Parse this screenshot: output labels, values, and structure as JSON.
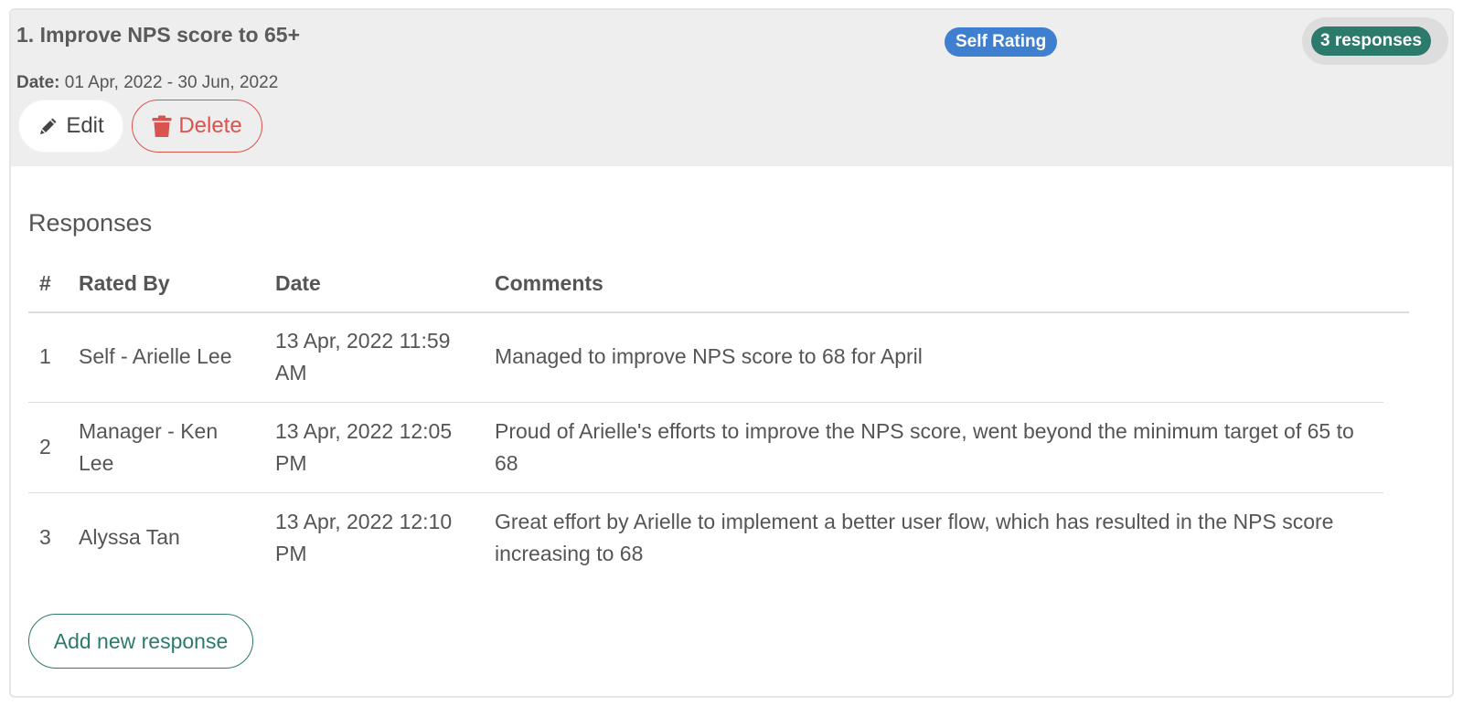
{
  "goal": {
    "title": "1. Improve NPS score to 65+",
    "rating_badge": "Self Rating",
    "responses_badge": "3 responses",
    "date_label": "Date:",
    "date_value": "01 Apr, 2022 - 30 Jun, 2022",
    "edit_label": "Edit",
    "delete_label": "Delete"
  },
  "responses": {
    "heading": "Responses",
    "columns": [
      "#",
      "Rated By",
      "Date",
      "Comments"
    ],
    "rows": [
      {
        "num": "1",
        "rated_by": "Self - Arielle Lee",
        "date": "13 Apr, 2022 11:59 AM",
        "comment": "Managed to improve NPS score to 68 for April"
      },
      {
        "num": "2",
        "rated_by": "Manager - Ken Lee",
        "date": "13 Apr, 2022 12:05 PM",
        "comment": "Proud of Arielle's efforts to improve the NPS score, went beyond the minimum target of 65 to 68"
      },
      {
        "num": "3",
        "rated_by": "Alyssa Tan",
        "date": "13 Apr, 2022 12:10 PM",
        "comment": "Great effort by Arielle to implement a better user flow, which has resulted in the NPS score increasing to 68"
      }
    ],
    "add_label": "Add new response"
  },
  "colors": {
    "header_bg": "#eeeeee",
    "self_rating_badge": "#3f7fcf",
    "responses_badge": "#2b7a6b",
    "delete": "#d9534f",
    "add_button": "#2b7a6b"
  },
  "icons": {
    "edit": "pencil-icon",
    "delete": "trash-icon"
  }
}
